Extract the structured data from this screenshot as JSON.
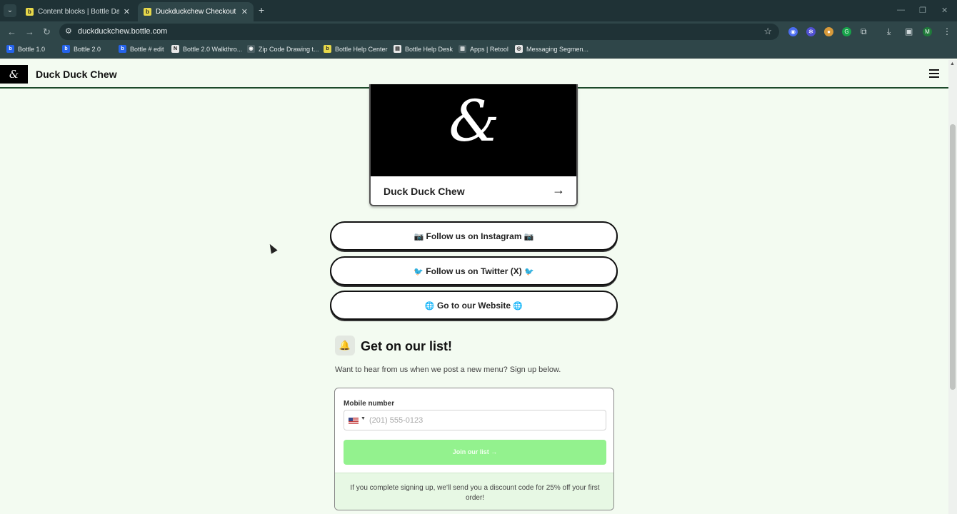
{
  "browser": {
    "tabs": [
      {
        "label": "Content blocks | Bottle Dashboard",
        "active": false
      },
      {
        "label": "Duckduckchew Checkout",
        "active": true
      }
    ],
    "url": "duckduckchew.bottle.com",
    "bookmarks": [
      "Bottle 1.0",
      "Bottle 2.0",
      "Bottle # edit",
      "Bottle 2.0 Walkthro...",
      "Zip Code Drawing t...",
      "Bottle Help Center",
      "Bottle Help Desk",
      "Apps | Retool",
      "Messaging Segmen..."
    ],
    "profile_initial": "M"
  },
  "site": {
    "logo_glyph": "&",
    "title": "Duck Duck Chew"
  },
  "card": {
    "name": "Duck Duck Chew"
  },
  "links": [
    {
      "label": "Follow us on Instagram",
      "emoji": "📷"
    },
    {
      "label": "Follow us on Twitter (X)",
      "emoji": "🐦"
    },
    {
      "label": "Go to our Website",
      "emoji": "🌐"
    }
  ],
  "signup": {
    "title": "Get on our list!",
    "subtitle": "Want to hear from us when we post a new menu? Sign up below.",
    "mobile_label": "Mobile number",
    "phone_placeholder": "(201) 555-0123",
    "button_label": "Join our list →",
    "promo_text": "If you complete signing up, we'll send you a discount code for 25% off your first order!"
  },
  "colors": {
    "page_bg": "#f3fbf1",
    "join_button": "#93f28e",
    "header_border": "#1c4a2a"
  }
}
